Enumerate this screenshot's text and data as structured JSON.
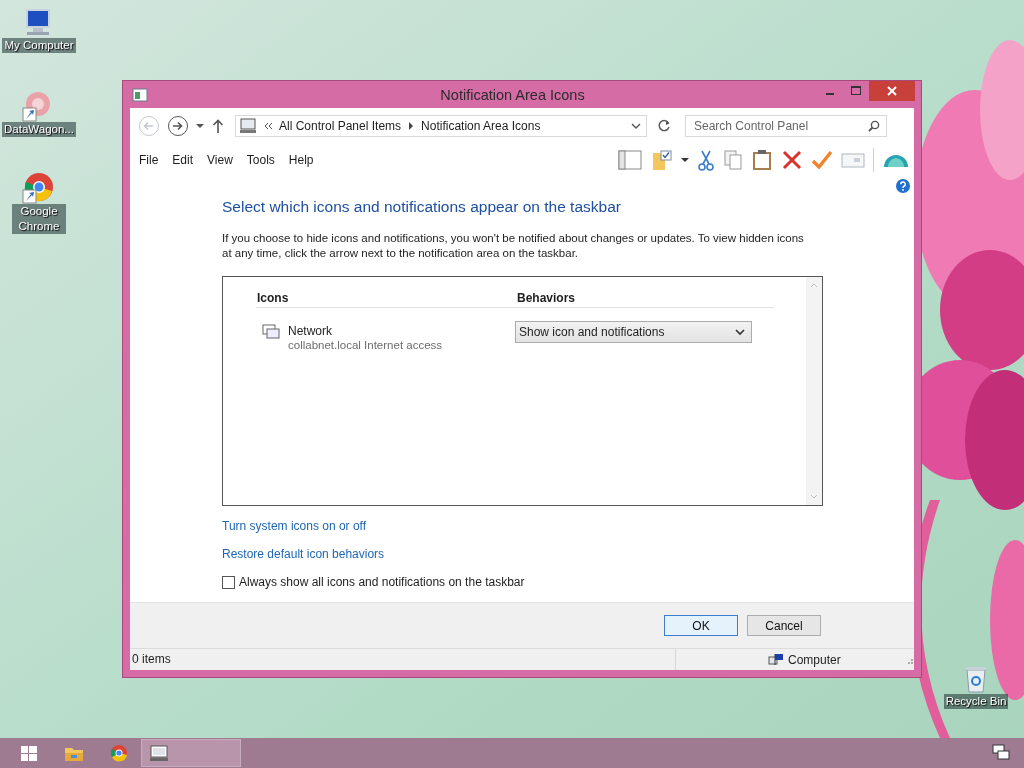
{
  "desktop_icons": [
    {
      "kind": "computer",
      "label": "My Computer"
    },
    {
      "kind": "app-shortcut",
      "label": "DataWagon..."
    },
    {
      "kind": "chrome-shortcut",
      "label": "Google Chrome"
    },
    {
      "kind": "recycle-bin",
      "label": "Recycle Bin"
    }
  ],
  "window": {
    "title": "Notification Area Icons",
    "breadcrumb": [
      "All Control Panel Items",
      "Notification Area Icons"
    ],
    "search": {
      "placeholder": "Search Control Panel"
    },
    "menu": [
      "File",
      "Edit",
      "View",
      "Tools",
      "Help"
    ],
    "heading": "Select which icons and notifications appear on the taskbar",
    "description": "If you choose to hide icons and notifications, you won't be notified about changes or updates. To view hidden icons at any time, click the arrow next to the notification area on the taskbar.",
    "table": {
      "columns": [
        "Icons",
        "Behaviors"
      ],
      "rows": [
        {
          "name": "Network",
          "detail": "collabnet.local Internet access",
          "behavior": "Show icon and notifications"
        }
      ]
    },
    "links": [
      "Turn system icons on or off",
      "Restore default icon behaviors"
    ],
    "checkbox": {
      "label": "Always show all icons and notifications on the taskbar",
      "checked": false
    },
    "buttons": [
      {
        "label": "OK",
        "default": true
      },
      {
        "label": "Cancel",
        "default": false
      }
    ],
    "status_bar": {
      "items": "0 items",
      "location": "Computer"
    }
  },
  "taskbar": {
    "items": [
      {
        "kind": "start",
        "active": false
      },
      {
        "kind": "explorer",
        "active": false
      },
      {
        "kind": "chrome",
        "active": false
      },
      {
        "kind": "control-panel",
        "active": true
      }
    ]
  }
}
